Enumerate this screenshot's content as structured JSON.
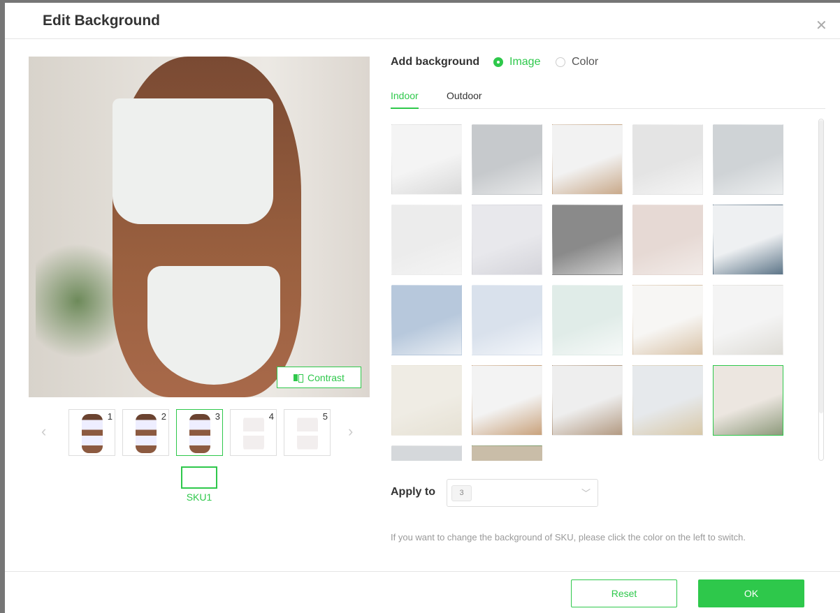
{
  "dialog": {
    "title": "Edit Background",
    "close_icon": "close-icon"
  },
  "preview": {
    "contrast_label": "Contrast",
    "contrast_icon": "contrast-icon"
  },
  "thumbnails": [
    {
      "num": "1",
      "selected": false
    },
    {
      "num": "2",
      "selected": false
    },
    {
      "num": "3",
      "selected": true
    },
    {
      "num": "4",
      "selected": false
    },
    {
      "num": "5",
      "selected": false
    }
  ],
  "sku": {
    "label": "SKU1",
    "color": "#ffffff"
  },
  "background": {
    "label": "Add background",
    "options": [
      {
        "label": "Image",
        "checked": true
      },
      {
        "label": "Color",
        "checked": false
      }
    ]
  },
  "tabs": [
    {
      "label": "Indoor",
      "active": true
    },
    {
      "label": "Outdoor",
      "active": false
    }
  ],
  "tiles": [
    {
      "colors": [
        "#f4f4f4",
        "#d9d9d9"
      ]
    },
    {
      "colors": [
        "#c6c9cc",
        "#e8e9ea"
      ]
    },
    {
      "colors": [
        "#f2f2f2",
        "#c9a98a"
      ]
    },
    {
      "colors": [
        "#e4e4e4",
        "#f5f5f5"
      ]
    },
    {
      "colors": [
        "#cfd3d6",
        "#eceeef"
      ]
    },
    {
      "colors": [
        "#ececec",
        "#f4f4f4"
      ]
    },
    {
      "colors": [
        "#e8e8ec",
        "#d4d4da"
      ]
    },
    {
      "colors": [
        "#8a8a8a",
        "#cfcfcf"
      ]
    },
    {
      "colors": [
        "#e6d9d4",
        "#f2ebe8"
      ]
    },
    {
      "colors": [
        "#eef0f2",
        "#5d7588"
      ]
    },
    {
      "colors": [
        "#b7c8dc",
        "#e8edf3"
      ]
    },
    {
      "colors": [
        "#d9e1ec",
        "#f3f6fa"
      ]
    },
    {
      "colors": [
        "#e0ece8",
        "#f6f9f8"
      ]
    },
    {
      "colors": [
        "#f7f6f4",
        "#d9c3a8"
      ]
    },
    {
      "colors": [
        "#f4f4f4",
        "#dedcd6"
      ]
    },
    {
      "colors": [
        "#efece4",
        "#e6e1d4"
      ]
    },
    {
      "colors": [
        "#f3f3f3",
        "#c9a27c"
      ]
    },
    {
      "colors": [
        "#eeeeee",
        "#b39a82"
      ]
    },
    {
      "colors": [
        "#e6e9ec",
        "#d8c8a8"
      ]
    },
    {
      "colors": [
        "#ece6e0",
        "#8e9a7c"
      ],
      "selected": true
    },
    {
      "colors": [
        "#d5d8db",
        "#eeeeee"
      ]
    },
    {
      "colors": [
        "#c9bda8",
        "#7a9a6a"
      ]
    }
  ],
  "apply": {
    "label": "Apply to",
    "value": "3",
    "chevron_icon": "chevron-down-icon"
  },
  "hint": "If you want to change the background of SKU, please click the color on the left to switch.",
  "footer": {
    "reset": "Reset",
    "ok": "OK"
  },
  "colors": {
    "accent": "#2ec84b"
  }
}
